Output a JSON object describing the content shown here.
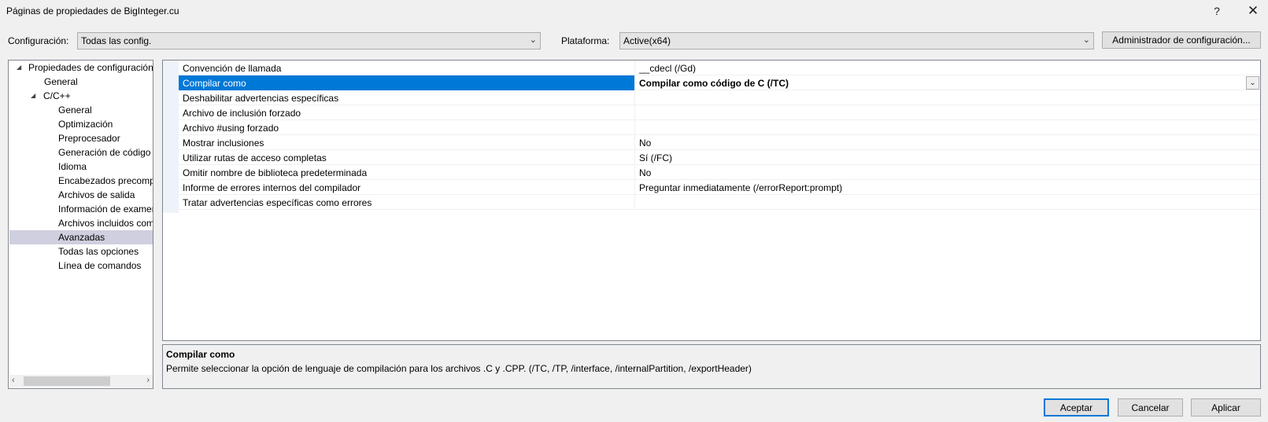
{
  "window": {
    "title": "Páginas de propiedades de BigInteger.cu",
    "help_glyph": "?",
    "close_glyph": "✕"
  },
  "toolbar": {
    "config_label": "Configuración:",
    "config_value": "Todas las config.",
    "platform_label": "Plataforma:",
    "platform_value": "Active(x64)",
    "config_manager_label": "Administrador de configuración..."
  },
  "tree": {
    "items": [
      {
        "label": "Propiedades de configuración",
        "expanded": true
      },
      {
        "label": "General"
      },
      {
        "label": "C/C++",
        "expanded": true
      },
      {
        "label": "General"
      },
      {
        "label": "Optimización"
      },
      {
        "label": "Preprocesador"
      },
      {
        "label": "Generación de código"
      },
      {
        "label": "Idioma"
      },
      {
        "label": "Encabezados precompilados"
      },
      {
        "label": "Archivos de salida"
      },
      {
        "label": "Información de examen"
      },
      {
        "label": "Archivos incluidos como"
      },
      {
        "label": "Avanzadas",
        "selected": true
      },
      {
        "label": "Todas las opciones"
      },
      {
        "label": "Línea de comandos"
      }
    ]
  },
  "grid": {
    "rows": [
      {
        "name": "Convención de llamada",
        "value": "__cdecl (/Gd)"
      },
      {
        "name": "Compilar como",
        "value": "Compilar como código de C (/TC)",
        "selected": true
      },
      {
        "name": "Deshabilitar advertencias específicas",
        "value": ""
      },
      {
        "name": "Archivo de inclusión forzado",
        "value": ""
      },
      {
        "name": "Archivo #using forzado",
        "value": ""
      },
      {
        "name": "Mostrar inclusiones",
        "value": "No"
      },
      {
        "name": "Utilizar rutas de acceso completas",
        "value": "Sí (/FC)"
      },
      {
        "name": "Omitir nombre de biblioteca predeterminada",
        "value": "No"
      },
      {
        "name": "Informe de errores internos del compilador",
        "value": "Preguntar inmediatamente (/errorReport:prompt)"
      },
      {
        "name": "Tratar advertencias específicas como errores",
        "value": ""
      }
    ]
  },
  "description": {
    "title": "Compilar como",
    "text": "Permite seleccionar la opción de lenguaje de compilación para los archivos .C y .CPP.     (/TC, /TP, /interface, /internalPartition, /exportHeader)"
  },
  "footer": {
    "ok_label": "Aceptar",
    "cancel_label": "Cancelar",
    "apply_label": "Aplicar"
  }
}
